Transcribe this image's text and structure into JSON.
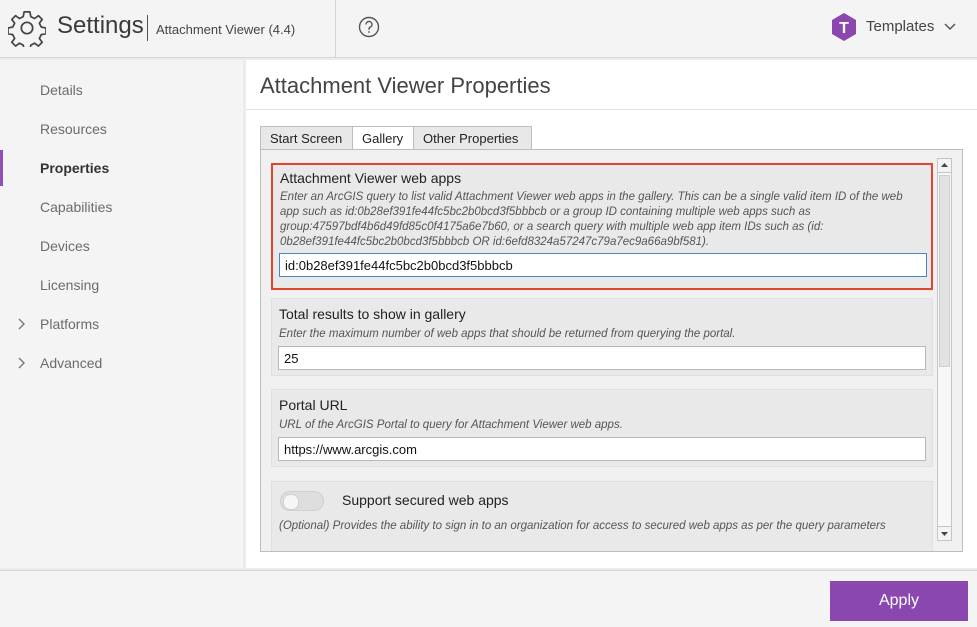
{
  "header": {
    "app_title": "Settings",
    "app_subtitle": "Attachment Viewer (4.4)",
    "templates_label": "Templates",
    "templates_logo_letter": "T",
    "brand_color": "#8a47b0"
  },
  "sidebar": {
    "items": [
      {
        "label": "Details",
        "active": false,
        "expandable": false
      },
      {
        "label": "Resources",
        "active": false,
        "expandable": false
      },
      {
        "label": "Properties",
        "active": true,
        "expandable": false
      },
      {
        "label": "Capabilities",
        "active": false,
        "expandable": false
      },
      {
        "label": "Devices",
        "active": false,
        "expandable": false
      },
      {
        "label": "Licensing",
        "active": false,
        "expandable": false
      },
      {
        "label": "Platforms",
        "active": false,
        "expandable": true
      },
      {
        "label": "Advanced",
        "active": false,
        "expandable": true
      }
    ]
  },
  "main": {
    "title": "Attachment Viewer Properties",
    "tabs": [
      {
        "label": "Start Screen",
        "active": false
      },
      {
        "label": "Gallery",
        "active": true
      },
      {
        "label": "Other Properties",
        "active": false
      }
    ],
    "fields": {
      "webapps": {
        "title": "Attachment Viewer web apps",
        "description": "Enter an ArcGIS query to list valid Attachment Viewer web apps in the gallery. This can be a single valid item ID of the web app such as id:0b28ef391fe44fc5bc2b0bcd3f5bbbcb or a group ID containing multiple web apps such as group:47597bdf4b6d49fd85c0f4175a6e7b60, or a search query with multiple web app item IDs such as (id: 0b28ef391fe44fc5bc2b0bcd3f5bbbcb OR id:6efd8324a57247c79a7ec9a66a9bf581).",
        "value": "id:0b28ef391fe44fc5bc2b0bcd3f5bbbcb"
      },
      "total_results": {
        "title": "Total results to show in gallery",
        "description": "Enter the maximum number of web apps that should be returned from querying the portal.",
        "value": "25"
      },
      "portal_url": {
        "title": "Portal URL",
        "description": "URL of the ArcGIS Portal to query for Attachment Viewer web apps.",
        "value": "https://www.arcgis.com"
      },
      "secured": {
        "title": "Support secured web apps",
        "description": "(Optional) Provides the ability to sign in to an organization for access to secured web apps as per the query parameters",
        "enabled": false
      }
    }
  },
  "footer": {
    "apply_label": "Apply"
  }
}
